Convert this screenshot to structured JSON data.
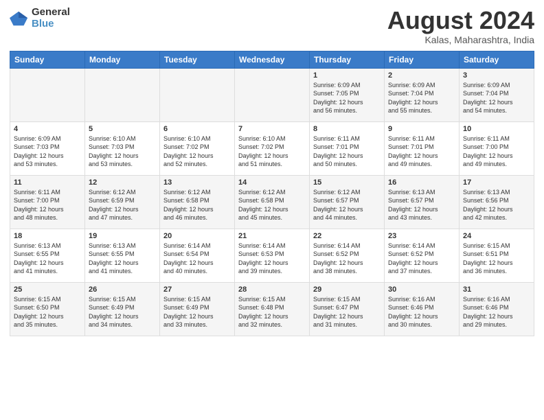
{
  "logo": {
    "general": "General",
    "blue": "Blue"
  },
  "title": "August 2024",
  "location": "Kalas, Maharashtra, India",
  "days_of_week": [
    "Sunday",
    "Monday",
    "Tuesday",
    "Wednesday",
    "Thursday",
    "Friday",
    "Saturday"
  ],
  "weeks": [
    [
      {
        "day": "",
        "info": ""
      },
      {
        "day": "",
        "info": ""
      },
      {
        "day": "",
        "info": ""
      },
      {
        "day": "",
        "info": ""
      },
      {
        "day": "1",
        "info": "Sunrise: 6:09 AM\nSunset: 7:05 PM\nDaylight: 12 hours\nand 56 minutes."
      },
      {
        "day": "2",
        "info": "Sunrise: 6:09 AM\nSunset: 7:04 PM\nDaylight: 12 hours\nand 55 minutes."
      },
      {
        "day": "3",
        "info": "Sunrise: 6:09 AM\nSunset: 7:04 PM\nDaylight: 12 hours\nand 54 minutes."
      }
    ],
    [
      {
        "day": "4",
        "info": "Sunrise: 6:09 AM\nSunset: 7:03 PM\nDaylight: 12 hours\nand 53 minutes."
      },
      {
        "day": "5",
        "info": "Sunrise: 6:10 AM\nSunset: 7:03 PM\nDaylight: 12 hours\nand 53 minutes."
      },
      {
        "day": "6",
        "info": "Sunrise: 6:10 AM\nSunset: 7:02 PM\nDaylight: 12 hours\nand 52 minutes."
      },
      {
        "day": "7",
        "info": "Sunrise: 6:10 AM\nSunset: 7:02 PM\nDaylight: 12 hours\nand 51 minutes."
      },
      {
        "day": "8",
        "info": "Sunrise: 6:11 AM\nSunset: 7:01 PM\nDaylight: 12 hours\nand 50 minutes."
      },
      {
        "day": "9",
        "info": "Sunrise: 6:11 AM\nSunset: 7:01 PM\nDaylight: 12 hours\nand 49 minutes."
      },
      {
        "day": "10",
        "info": "Sunrise: 6:11 AM\nSunset: 7:00 PM\nDaylight: 12 hours\nand 49 minutes."
      }
    ],
    [
      {
        "day": "11",
        "info": "Sunrise: 6:11 AM\nSunset: 7:00 PM\nDaylight: 12 hours\nand 48 minutes."
      },
      {
        "day": "12",
        "info": "Sunrise: 6:12 AM\nSunset: 6:59 PM\nDaylight: 12 hours\nand 47 minutes."
      },
      {
        "day": "13",
        "info": "Sunrise: 6:12 AM\nSunset: 6:58 PM\nDaylight: 12 hours\nand 46 minutes."
      },
      {
        "day": "14",
        "info": "Sunrise: 6:12 AM\nSunset: 6:58 PM\nDaylight: 12 hours\nand 45 minutes."
      },
      {
        "day": "15",
        "info": "Sunrise: 6:12 AM\nSunset: 6:57 PM\nDaylight: 12 hours\nand 44 minutes."
      },
      {
        "day": "16",
        "info": "Sunrise: 6:13 AM\nSunset: 6:57 PM\nDaylight: 12 hours\nand 43 minutes."
      },
      {
        "day": "17",
        "info": "Sunrise: 6:13 AM\nSunset: 6:56 PM\nDaylight: 12 hours\nand 42 minutes."
      }
    ],
    [
      {
        "day": "18",
        "info": "Sunrise: 6:13 AM\nSunset: 6:55 PM\nDaylight: 12 hours\nand 41 minutes."
      },
      {
        "day": "19",
        "info": "Sunrise: 6:13 AM\nSunset: 6:55 PM\nDaylight: 12 hours\nand 41 minutes."
      },
      {
        "day": "20",
        "info": "Sunrise: 6:14 AM\nSunset: 6:54 PM\nDaylight: 12 hours\nand 40 minutes."
      },
      {
        "day": "21",
        "info": "Sunrise: 6:14 AM\nSunset: 6:53 PM\nDaylight: 12 hours\nand 39 minutes."
      },
      {
        "day": "22",
        "info": "Sunrise: 6:14 AM\nSunset: 6:52 PM\nDaylight: 12 hours\nand 38 minutes."
      },
      {
        "day": "23",
        "info": "Sunrise: 6:14 AM\nSunset: 6:52 PM\nDaylight: 12 hours\nand 37 minutes."
      },
      {
        "day": "24",
        "info": "Sunrise: 6:15 AM\nSunset: 6:51 PM\nDaylight: 12 hours\nand 36 minutes."
      }
    ],
    [
      {
        "day": "25",
        "info": "Sunrise: 6:15 AM\nSunset: 6:50 PM\nDaylight: 12 hours\nand 35 minutes."
      },
      {
        "day": "26",
        "info": "Sunrise: 6:15 AM\nSunset: 6:49 PM\nDaylight: 12 hours\nand 34 minutes."
      },
      {
        "day": "27",
        "info": "Sunrise: 6:15 AM\nSunset: 6:49 PM\nDaylight: 12 hours\nand 33 minutes."
      },
      {
        "day": "28",
        "info": "Sunrise: 6:15 AM\nSunset: 6:48 PM\nDaylight: 12 hours\nand 32 minutes."
      },
      {
        "day": "29",
        "info": "Sunrise: 6:15 AM\nSunset: 6:47 PM\nDaylight: 12 hours\nand 31 minutes."
      },
      {
        "day": "30",
        "info": "Sunrise: 6:16 AM\nSunset: 6:46 PM\nDaylight: 12 hours\nand 30 minutes."
      },
      {
        "day": "31",
        "info": "Sunrise: 6:16 AM\nSunset: 6:46 PM\nDaylight: 12 hours\nand 29 minutes."
      }
    ]
  ]
}
